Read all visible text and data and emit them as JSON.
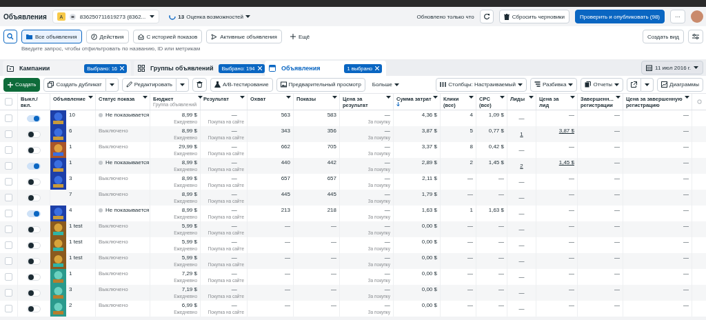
{
  "header": {
    "title": "Объявления",
    "account_badge": "A",
    "account": "836250711619273 (8362...",
    "score": "13",
    "score_label": "Оценка возможностей",
    "updated": "Обновлено только что",
    "discard_button": "Сбросить черновики",
    "publish_button": "Проверить и опубликовать (98)",
    "more_button": "···"
  },
  "filters": {
    "tabs": [
      {
        "label": "Все объявления",
        "selected": true
      },
      {
        "label": "Действия",
        "selected": false
      },
      {
        "label": "С историей показов",
        "selected": false
      },
      {
        "label": "Активные объявления",
        "selected": false
      }
    ],
    "more_tab": "Ещё",
    "create_view": "Создать вид",
    "search": {
      "placeholder": "Введите запрос, чтобы отфильтровать по названию, ID или метрикам"
    }
  },
  "levels": [
    {
      "label": "Кампании",
      "badge": "Выбрано: 16",
      "selected": false
    },
    {
      "label": "Группы объявлений",
      "badge": "Выбрано: 194",
      "selected": false
    },
    {
      "label": "Объявления",
      "badge": "1 выбрано",
      "selected": true
    }
  ],
  "date": "11 июл 2016 г.",
  "toolbar": {
    "create": "Создать",
    "duplicate": "Создать дубликат",
    "edit": "Редактировать",
    "ab_test": "A/B-тестирование",
    "preview": "Предварительный просмотр",
    "more": "Больше",
    "columns": "Столбцы: Настраиваемый",
    "breakdown": "Разбивка",
    "reports": "Отчеты",
    "charts": "Диаграммы"
  },
  "table": {
    "all_checked": false,
    "columns": [
      {
        "label": "Выкл./ вкл."
      },
      {
        "label": "Объявление"
      },
      {
        "label": "Статус показа"
      },
      {
        "label": "Бюджет",
        "sub": "Группа объявлений"
      },
      {
        "label": "Результат"
      },
      {
        "label": "Охват"
      },
      {
        "label": "Показы"
      },
      {
        "label": "Цена за результат"
      },
      {
        "label": "Сумма затрат",
        "sorted": true
      },
      {
        "label": "Клики (все)"
      },
      {
        "label": "CPC (все)"
      },
      {
        "label": "Лиды"
      },
      {
        "label": "Цена за лид"
      },
      {
        "label": "Завершенн... регистрации"
      },
      {
        "label": "Цена за завершенную регистрацию"
      }
    ],
    "rows": [
      {
        "checked": false,
        "on": true,
        "thumbnail": {
          "kind": "blue"
        },
        "name": "10",
        "status": {
          "text": "Не показывается",
          "kind": "inactive"
        },
        "budget": "8,99 $",
        "budget_period": "Ежедневно",
        "result": "—",
        "result_type": "Покупка на сайте",
        "reach": "563",
        "impressions": "583",
        "cost_per_result": "—",
        "cost_type": "За покупку",
        "spend": "4,36 $",
        "clicks": "4",
        "cpc": "1,09 $",
        "leads": "—",
        "cost_per_lead": "—",
        "registrations": "—",
        "cost_per_registration": "—",
        "linked": false
      },
      {
        "checked": false,
        "on": false,
        "thumbnail": {
          "kind": "blue"
        },
        "name": "6",
        "status": {
          "text": "Выключено",
          "kind": "off"
        },
        "budget": "8,99 $",
        "budget_period": "Ежедневно",
        "result": "—",
        "result_type": "Покупка на сайте",
        "reach": "343",
        "impressions": "356",
        "cost_per_result": "—",
        "cost_type": "За покупку",
        "spend": "3,87 $",
        "clicks": "5",
        "cpc": "0,77 $",
        "leads": "1",
        "cost_per_lead": "3,87 $",
        "registrations": "—",
        "cost_per_registration": "—",
        "linked": true
      },
      {
        "checked": false,
        "on": false,
        "thumbnail": {
          "kind": "orange"
        },
        "name": "1",
        "status": {
          "text": "Выключено",
          "kind": "off"
        },
        "budget": "29,99 $",
        "budget_period": "Ежедневно",
        "result": "—",
        "result_type": "Покупка на сайте",
        "reach": "662",
        "impressions": "705",
        "cost_per_result": "—",
        "cost_type": "За покупку",
        "spend": "3,37 $",
        "clicks": "8",
        "cpc": "0,42 $",
        "leads": "—",
        "cost_per_lead": "—",
        "registrations": "—",
        "cost_per_registration": "—",
        "linked": false
      },
      {
        "checked": false,
        "on": true,
        "thumbnail": {
          "kind": "blue"
        },
        "name": "1",
        "status": {
          "text": "Не показывается",
          "kind": "inactive"
        },
        "budget": "8,99 $",
        "budget_period": "Ежедневно",
        "result": "—",
        "result_type": "Покупка на сайте",
        "reach": "440",
        "impressions": "442",
        "cost_per_result": "—",
        "cost_type": "За покупку",
        "spend": "2,89 $",
        "clicks": "2",
        "cpc": "1,45 $",
        "leads": "2",
        "cost_per_lead": "1,45 $",
        "registrations": "—",
        "cost_per_registration": "—",
        "linked": true
      },
      {
        "checked": false,
        "on": false,
        "thumbnail": {
          "kind": "blue"
        },
        "name": "3",
        "status": {
          "text": "Выключено",
          "kind": "off"
        },
        "budget": "8,99 $",
        "budget_period": "Ежедневно",
        "result": "—",
        "result_type": "Покупка на сайте",
        "reach": "657",
        "impressions": "657",
        "cost_per_result": "—",
        "cost_type": "За покупку",
        "spend": "2,11 $",
        "clicks": "—",
        "cpc": "—",
        "leads": "—",
        "cost_per_lead": "—",
        "registrations": "—",
        "cost_per_registration": "—",
        "linked": false
      },
      {
        "checked": false,
        "on": false,
        "name": "7",
        "status": {
          "text": "Выключено",
          "kind": "off"
        },
        "budget": "8,99 $",
        "budget_period": "Ежедневно",
        "result": "—",
        "result_type": "Покупка на сайте",
        "reach": "445",
        "impressions": "445",
        "cost_per_result": "—",
        "cost_type": "За покупку",
        "spend": "1,79 $",
        "clicks": "—",
        "cpc": "—",
        "leads": "—",
        "cost_per_lead": "—",
        "registrations": "—",
        "cost_per_registration": "—",
        "linked": false
      },
      {
        "checked": false,
        "on": true,
        "thumbnail": {
          "kind": "blue"
        },
        "name": "4",
        "status": {
          "text": "Не показывается",
          "kind": "inactive"
        },
        "budget": "8,99 $",
        "budget_period": "Ежедневно",
        "result": "—",
        "result_type": "Покупка на сайте",
        "reach": "213",
        "impressions": "218",
        "cost_per_result": "—",
        "cost_type": "За покупку",
        "spend": "1,63 $",
        "clicks": "1",
        "cpc": "1,63 $",
        "leads": "—",
        "cost_per_lead": "—",
        "registrations": "—",
        "cost_per_registration": "—",
        "linked": false
      },
      {
        "checked": false,
        "on": false,
        "thumbnail": {
          "kind": "gold"
        },
        "name": "1 test",
        "status": {
          "text": "Выключено",
          "kind": "off"
        },
        "budget": "5,99 $",
        "budget_period": "Ежедневно",
        "result": "—",
        "result_type": "Покупка на сайте",
        "reach": "—",
        "impressions": "—",
        "cost_per_result": "—",
        "cost_type": "За покупку",
        "spend": "0,00 $",
        "clicks": "—",
        "cpc": "—",
        "leads": "—",
        "cost_per_lead": "—",
        "registrations": "—",
        "cost_per_registration": "—",
        "linked": false
      },
      {
        "checked": false,
        "on": false,
        "thumbnail": {
          "kind": "gold"
        },
        "name": "1 test",
        "status": {
          "text": "Выключено",
          "kind": "off"
        },
        "budget": "5,99 $",
        "budget_period": "Ежедневно",
        "result": "—",
        "result_type": "Покупка на сайте",
        "reach": "—",
        "impressions": "—",
        "cost_per_result": "—",
        "cost_type": "За покупку",
        "spend": "0,00 $",
        "clicks": "—",
        "cpc": "—",
        "leads": "—",
        "cost_per_lead": "—",
        "registrations": "—",
        "cost_per_registration": "—",
        "linked": false
      },
      {
        "checked": false,
        "on": false,
        "thumbnail": {
          "kind": "gold"
        },
        "name": "1 test",
        "status": {
          "text": "Выключено",
          "kind": "off"
        },
        "budget": "5,99 $",
        "budget_period": "Ежедневно",
        "result": "—",
        "result_type": "Покупка на сайте",
        "reach": "—",
        "impressions": "—",
        "cost_per_result": "—",
        "cost_type": "За покупку",
        "spend": "0,00 $",
        "clicks": "—",
        "cpc": "—",
        "leads": "—",
        "cost_per_lead": "—",
        "registrations": "—",
        "cost_per_registration": "—",
        "linked": false
      },
      {
        "checked": false,
        "on": false,
        "thumbnail": {
          "kind": "teal"
        },
        "name": "1",
        "status": {
          "text": "Выключено",
          "kind": "off"
        },
        "budget": "7,29 $",
        "budget_period": "Ежедневно",
        "result": "—",
        "result_type": "Покупка на сайте",
        "reach": "—",
        "impressions": "—",
        "cost_per_result": "—",
        "cost_type": "За покупку",
        "spend": "0,00 $",
        "clicks": "—",
        "cpc": "—",
        "leads": "—",
        "cost_per_lead": "—",
        "registrations": "—",
        "cost_per_registration": "—",
        "linked": false
      },
      {
        "checked": false,
        "on": false,
        "thumbnail": {
          "kind": "teal"
        },
        "name": "3",
        "status": {
          "text": "Выключено",
          "kind": "off"
        },
        "budget": "7,19 $",
        "budget_period": "Ежедневно",
        "result": "—",
        "result_type": "Покупка на сайте",
        "reach": "—",
        "impressions": "—",
        "cost_per_result": "—",
        "cost_type": "За покупку",
        "spend": "0,00 $",
        "clicks": "—",
        "cpc": "—",
        "leads": "—",
        "cost_per_lead": "—",
        "registrations": "—",
        "cost_per_registration": "—",
        "linked": false
      },
      {
        "checked": false,
        "on": false,
        "thumbnail": {
          "kind": "teal"
        },
        "name": "2",
        "status": {
          "text": "Выключено",
          "kind": "off"
        },
        "budget": "6,99 $",
        "budget_period": "Ежедневно",
        "result": "—",
        "result_type": "Покупка на сайте",
        "reach": "—",
        "impressions": "—",
        "cost_per_result": "—",
        "cost_type": "За покупку",
        "spend": "0,00 $",
        "clicks": "—",
        "cpc": "—",
        "leads": "—",
        "cost_per_lead": "—",
        "registrations": "—",
        "cost_per_registration": "—",
        "linked": false
      }
    ]
  }
}
